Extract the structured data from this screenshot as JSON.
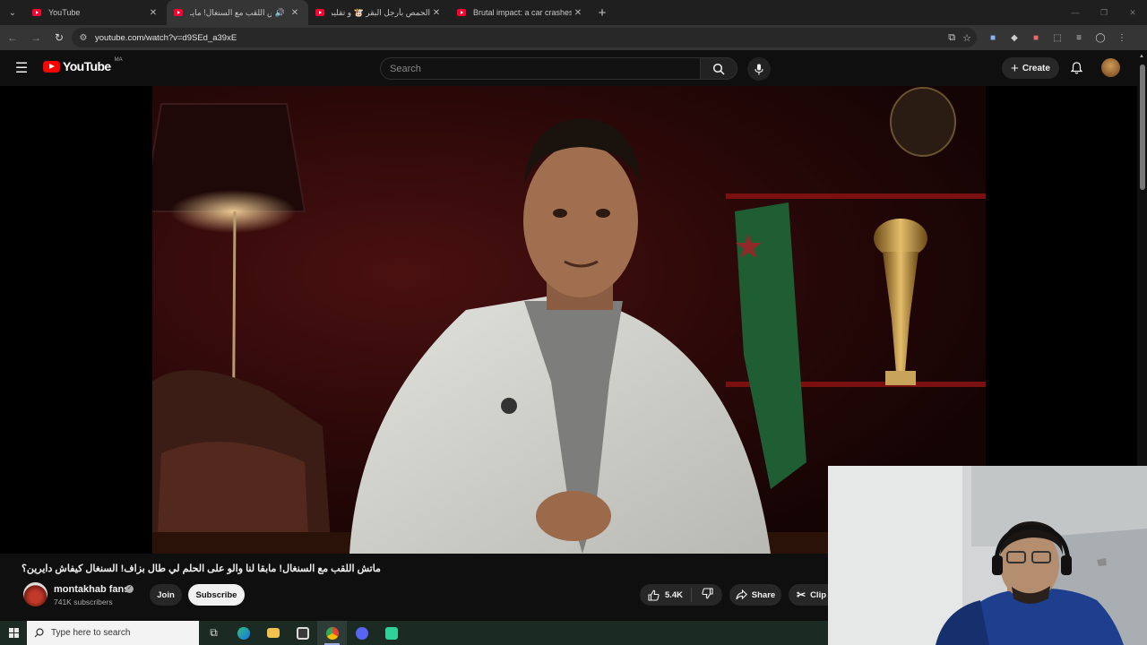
{
  "browser": {
    "tabs": [
      {
        "title": "YouTube",
        "active": false,
        "audio": false
      },
      {
        "title": "ماتش اللقب مع السنغال! مايـ",
        "active": true,
        "audio": true
      },
      {
        "title": "الحمص بأرجل البقر 🐮 و تقليم أ...",
        "active": false,
        "audio": false
      },
      {
        "title": "Brutal impact: a car crashes",
        "active": false,
        "audio": false
      }
    ],
    "new_tab_label": "+",
    "url": "youtube.com/watch?v=d9SEd_a39xE"
  },
  "youtube_header": {
    "logo_text": "YouTube",
    "country_code": "MA",
    "search_placeholder": "Search",
    "create_label": "Create"
  },
  "video": {
    "title": "ماتش اللقب مع السنغال! مابقا لنا والو على الحلم لي طال بزاف! السنغال كيفاش دايرين؟",
    "channel_name": "montakhab fans",
    "subscribers": "741K subscribers",
    "join_label": "Join",
    "subscribe_label": "Subscribe",
    "likes": "5.4K",
    "share_label": "Share",
    "clip_label": "Clip"
  },
  "taskbar": {
    "search_placeholder": "Type here to search"
  },
  "colors": {
    "youtube_red": "#ff0000",
    "background": "#0f0f0f",
    "button_bg": "#272727"
  }
}
